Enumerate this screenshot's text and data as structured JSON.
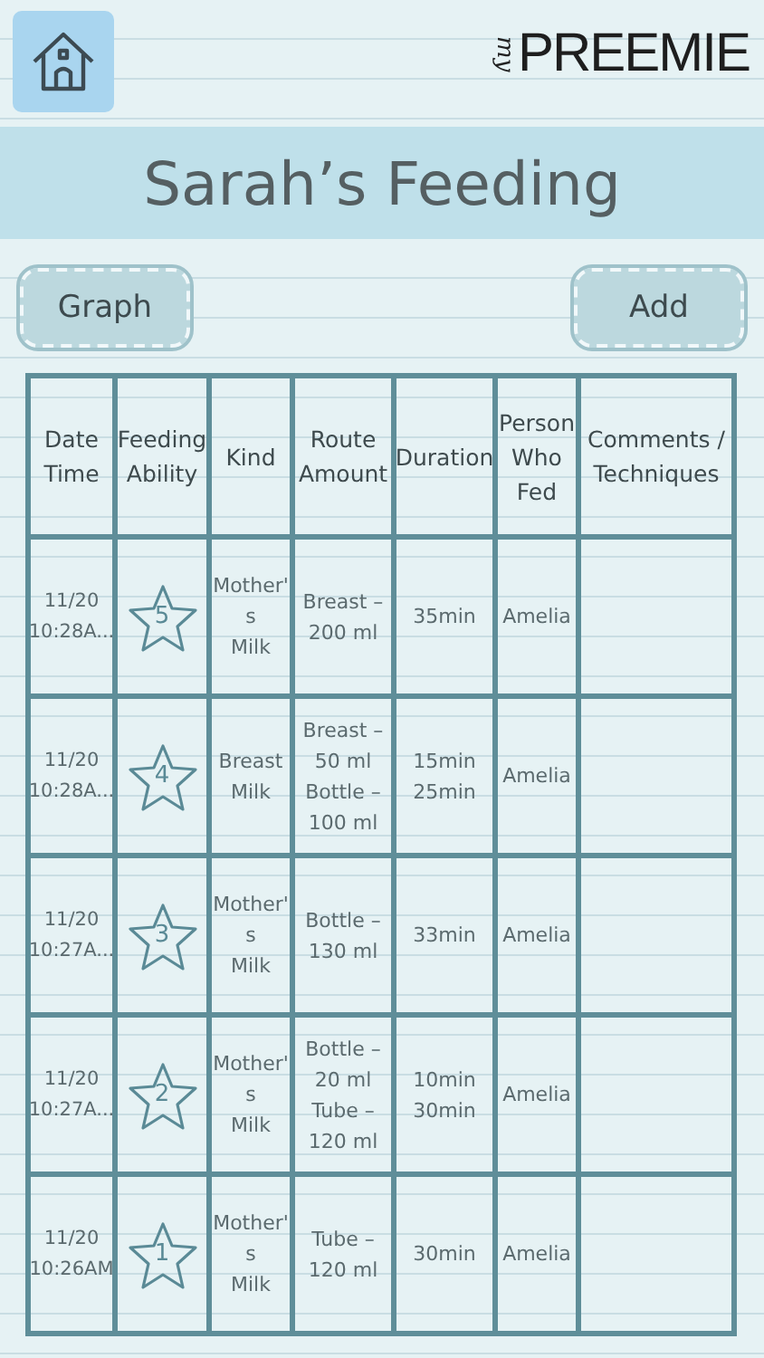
{
  "logo": {
    "prefix": "my",
    "name": "PREEMIE"
  },
  "title": "Sarah’s Feeding",
  "buttons": {
    "left": "Graph",
    "right": "Add"
  },
  "table": {
    "columns": [
      "Date\nTime",
      "Feeding\nAbility",
      "Kind",
      "Route\nAmount",
      "Duration",
      "Person\nWho\nFed",
      "Comments /\nTechniques"
    ],
    "rows": [
      {
        "date": "11/20\n10:28A...",
        "ability": "5",
        "kind": "Mother'\ns\nMilk",
        "route": "Breast –\n200 ml",
        "duration": "35min",
        "person": "Amelia"
      },
      {
        "date": "11/20\n10:28A...",
        "ability": "4",
        "kind": "Breast\nMilk",
        "route": "Breast –\n50 ml\nBottle –\n100 ml",
        "duration": "15min\n25min",
        "person": "Amelia"
      },
      {
        "date": "11/20\n10:27A...",
        "ability": "3",
        "kind": "Mother'\ns\nMilk",
        "route": "Bottle –\n130 ml",
        "duration": "33min",
        "person": "Amelia"
      },
      {
        "date": "11/20\n10:27A...",
        "ability": "2",
        "kind": "Mother'\ns\nMilk",
        "route": "Bottle –\n20 ml\nTube –\n120 ml",
        "duration": "10min\n30min",
        "person": "Amelia"
      },
      {
        "date": "11/20\n10:26AM",
        "ability": "1",
        "kind": "Mother'\ns\nMilk",
        "route": "Tube –\n120 ml",
        "duration": "30min",
        "person": "Amelia"
      }
    ]
  }
}
